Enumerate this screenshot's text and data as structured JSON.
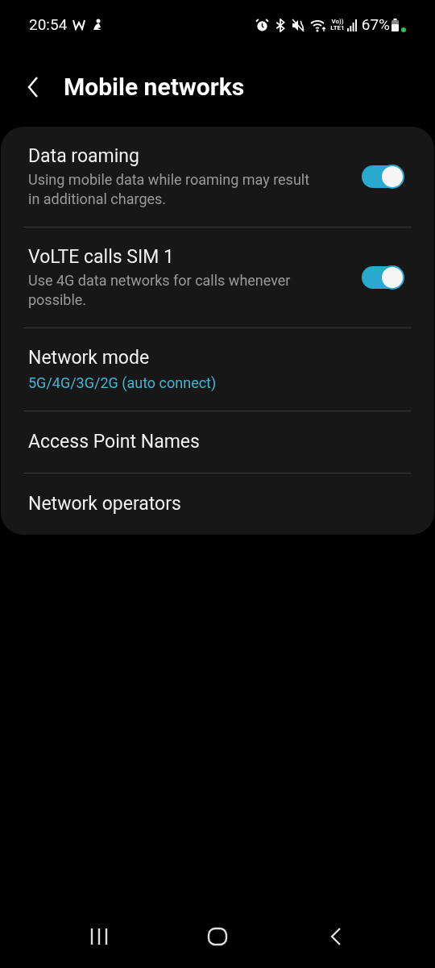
{
  "status_bar": {
    "time": "20:54",
    "volte": "Vo))",
    "network": "LTE1",
    "battery": "67%"
  },
  "header": {
    "title": "Mobile networks"
  },
  "items": [
    {
      "kind": "switch",
      "title": "Data roaming",
      "subtitle": "Using mobile data while roaming may result in additional charges.",
      "on": true
    },
    {
      "kind": "switch",
      "title": "VoLTE calls SIM 1",
      "subtitle": "Use 4G data networks for calls whenever possible.",
      "on": true
    },
    {
      "kind": "value",
      "title": "Network mode",
      "subtitle": "5G/4G/3G/2G (auto connect)"
    },
    {
      "kind": "plain",
      "title": "Access Point Names"
    },
    {
      "kind": "plain",
      "title": "Network operators"
    }
  ]
}
